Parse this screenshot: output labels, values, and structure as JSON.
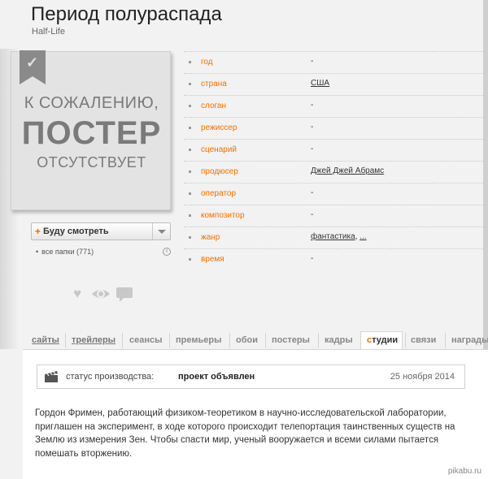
{
  "movie": {
    "title": "Период полураспада",
    "original_title": "Half-Life"
  },
  "poster": {
    "line1": "К СОЖАЛЕНИЮ,",
    "line2": "ПОСТЕР",
    "line3": "ОТСУТСТВУЕТ",
    "check_glyph": "✓"
  },
  "watchlist": {
    "button_plus": "+",
    "button_label": "Буду смотреть",
    "folders_label": "все папки (771)",
    "info_glyph": "i"
  },
  "icons": [
    "heart-icon",
    "eye-icon",
    "comment-icon"
  ],
  "info": [
    {
      "key": "год",
      "value": "-"
    },
    {
      "key": "страна",
      "value": "США",
      "link": true
    },
    {
      "key": "слоган",
      "value": "-"
    },
    {
      "key": "режиссер",
      "value": "-"
    },
    {
      "key": "сценарий",
      "value": "-"
    },
    {
      "key": "продюсер",
      "value": "Джей Джей Абрамс",
      "link": true
    },
    {
      "key": "оператор",
      "value": "-"
    },
    {
      "key": "композитор",
      "value": "-"
    },
    {
      "key": "жанр",
      "value": "фантастика",
      "value_extra": "...",
      "link": true
    },
    {
      "key": "время",
      "value": "-"
    }
  ],
  "tabs": [
    {
      "label": "сайты",
      "link": true
    },
    {
      "label": "трейлеры",
      "link": true
    },
    {
      "label": "сеансы"
    },
    {
      "label": "премьеры"
    },
    {
      "label": "обои"
    },
    {
      "label": "постеры"
    },
    {
      "label": "кадры"
    },
    {
      "label": "студии",
      "active": true,
      "highlight": "с"
    },
    {
      "label": "связи"
    },
    {
      "label": "награды"
    }
  ],
  "status": {
    "label": "статус производства:",
    "value": "проект объявлен",
    "date": "25 ноября 2014"
  },
  "description": "Гордон Фримен, работающий физиком-теоретиком в научно-исследовательской лаборатории, приглашен на эксперимент, в ходе которого происходит телепортация таинственных существ на Землю из измерения Зен. Чтобы спасти мир, ученый вооружается и всеми силами пытается помешать вторжению.",
  "watermark": "pikabu.ru",
  "colors": {
    "accent": "#f07000",
    "key_text": "#f07000"
  }
}
